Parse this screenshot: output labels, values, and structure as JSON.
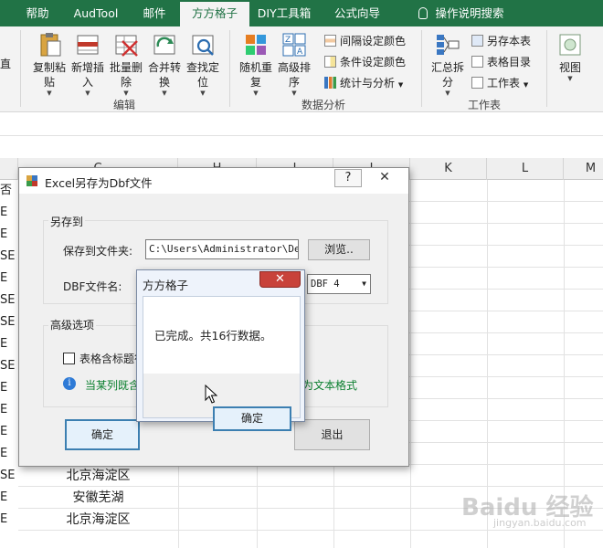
{
  "tabs": [
    "帮助",
    "AudTool",
    "邮件",
    "方方格子",
    "DIY工具箱",
    "公式向导",
    "操作说明搜索"
  ],
  "ribbon": {
    "left_partial": "直",
    "buttons": [
      {
        "l1": "复制粘",
        "l2": "贴"
      },
      {
        "l1": "新增插",
        "l2": "入"
      },
      {
        "l1": "批量删",
        "l2": "除"
      },
      {
        "l1": "合并转",
        "l2": "换"
      },
      {
        "l1": "查找定",
        "l2": "位"
      },
      {
        "l1": "随机重",
        "l2": "复"
      },
      {
        "l1": "高级排",
        "l2": "序"
      }
    ],
    "analysis_items": [
      "间隔设定颜色",
      "条件设定颜色",
      "统计与分析"
    ],
    "huizong": {
      "l1": "汇总拆",
      "l2": "分"
    },
    "worktable_items": [
      "另存本表",
      "表格目录",
      "工作表"
    ],
    "view": "视图",
    "groups": [
      "编辑",
      "数据分析",
      "工作表"
    ]
  },
  "sheet": {
    "columns": [
      "C",
      "H",
      "I",
      "J",
      "K",
      "L",
      "M"
    ],
    "row_fragments": [
      "否",
      "E",
      "E",
      "SE",
      "E",
      "SE",
      "SE",
      "E",
      "SE",
      "E",
      "E",
      "E",
      "E",
      "SE",
      "E",
      "E"
    ],
    "c_values": [
      "北京海淀区",
      "安徽芜湖",
      "北京海淀区"
    ]
  },
  "dialog": {
    "title": "Excel另存为Dbf文件",
    "help": "?",
    "close": "✕",
    "save_group": "另存到",
    "folder_label": "保存到文件夹:",
    "folder_value": "C:\\Users\\Administrator\\Desk",
    "browse": "浏览..",
    "dbf_label": "DBF文件名:",
    "dbf_version": "DBF 4",
    "adv_group": "高级选项",
    "header_checkbox": "表格含标题行",
    "hint_left": "当某列既含",
    "hint_right": "为文本格式",
    "ok": "确定",
    "exit": "退出"
  },
  "message": {
    "title": "方方格子",
    "close": "✕",
    "text": "已完成。共16行数据。",
    "ok": "确定"
  },
  "watermark": {
    "main": "Baidu 经验",
    "sub": "jingyan.baidu.com"
  }
}
